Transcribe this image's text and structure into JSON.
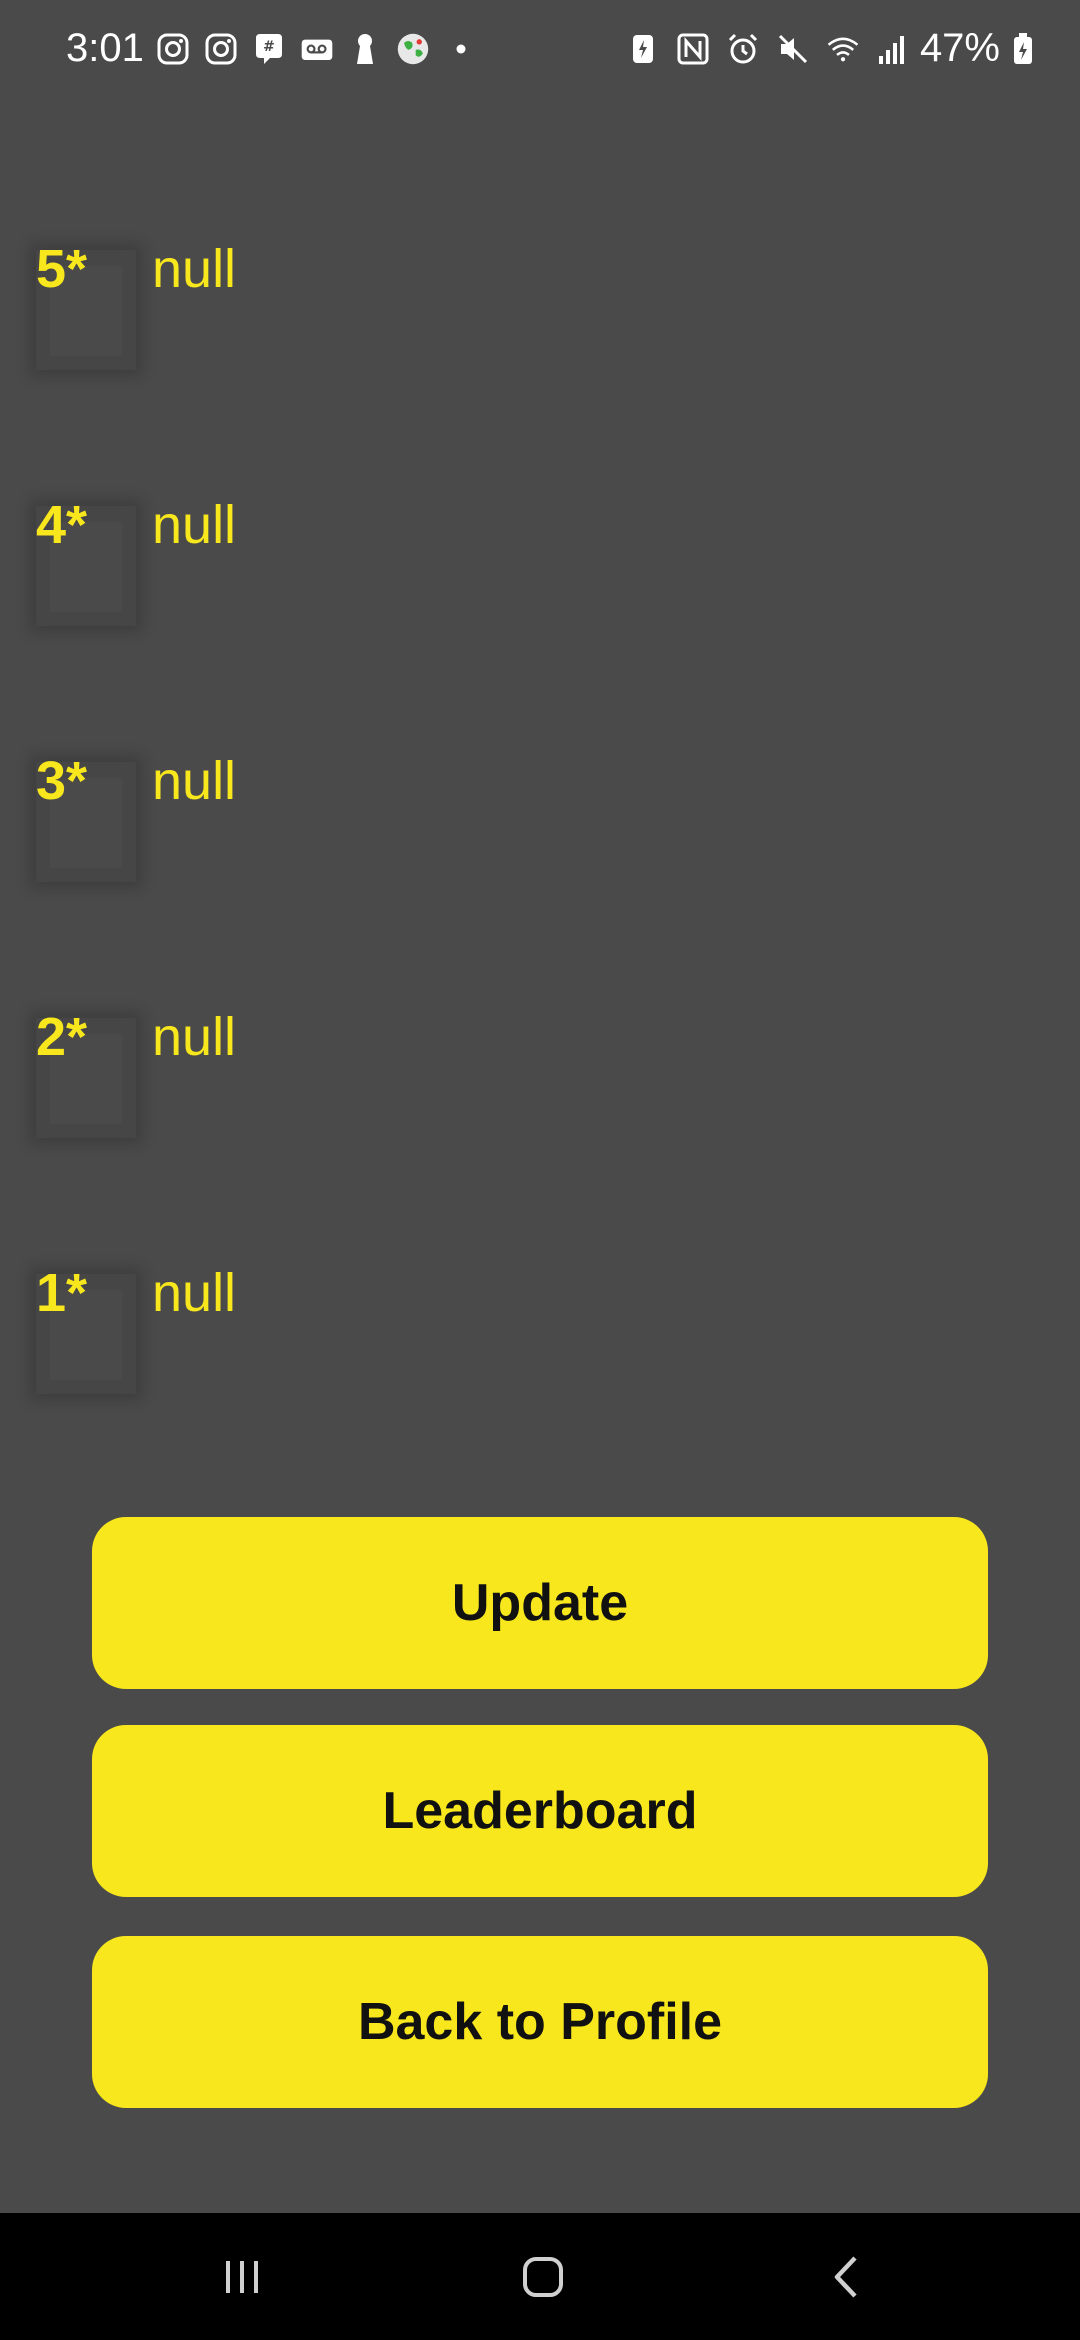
{
  "status_bar": {
    "time": "3:01",
    "battery": "47%",
    "left_icons": [
      "instagram-icon",
      "instagram-icon",
      "messenger-icon",
      "voicemail-icon",
      "keyhole-icon",
      "globe-icon",
      "dot-icon"
    ],
    "right_icons": [
      "battery-saver-icon",
      "nfc-icon",
      "alarm-icon",
      "mute-icon",
      "wifi-icon",
      "signal-icon"
    ]
  },
  "ratings": [
    {
      "stars": "5*",
      "name": "null"
    },
    {
      "stars": "4*",
      "name": "null"
    },
    {
      "stars": "3*",
      "name": "null"
    },
    {
      "stars": "2*",
      "name": "null"
    },
    {
      "stars": "1*",
      "name": "null"
    }
  ],
  "buttons": {
    "update": "Update",
    "leaderboard": "Leaderboard",
    "back_to_profile": "Back to Profile"
  },
  "nav": {
    "items": [
      "recents-icon",
      "home-icon",
      "back-icon"
    ]
  },
  "colors": {
    "background": "#4a4a4a",
    "accent": "#f8e71c",
    "button_text": "#111111",
    "nav_background": "#000000"
  }
}
